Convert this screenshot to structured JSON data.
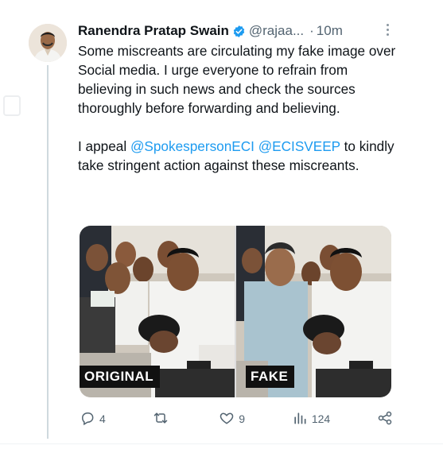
{
  "tweet": {
    "author_name": "Ranendra Pratap Swain",
    "handle": "@rajaa...",
    "time": "10m",
    "paragraph1": "Some miscreants are circulating my fake image over Social media. I urge everyone to refrain from believing in such news and check the sources thoroughly before forwarding and believing.",
    "paragraph2_start": "I appeal ",
    "mention1": "@SpokespersonECI",
    "mention2": "@ECISVEEP",
    "paragraph2_end": " to kindly take stringent action against these miscreants.",
    "images": [
      {
        "label": "ORIGINAL"
      },
      {
        "label": "FAKE"
      }
    ]
  },
  "actions": {
    "replies": "4",
    "retweets": "",
    "likes": "9",
    "views": "124"
  },
  "colors": {
    "accent": "#1d9bf0",
    "secondary_text": "#536471",
    "verified_badge": "#1d9bf0"
  },
  "icons": [
    "verified-badge-icon",
    "more-icon",
    "reply-icon",
    "retweet-icon",
    "like-icon",
    "views-icon",
    "share-icon"
  ]
}
